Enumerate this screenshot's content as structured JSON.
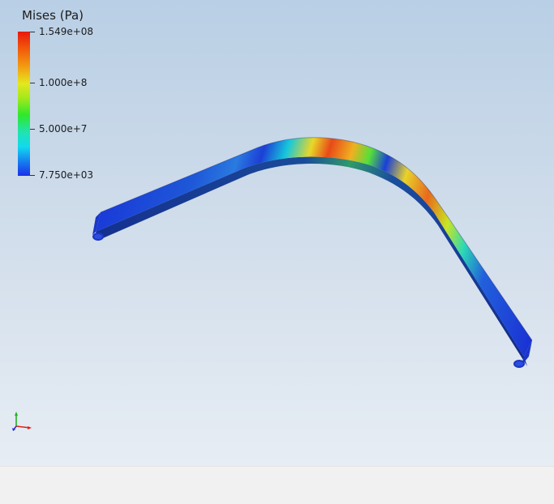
{
  "legend": {
    "title": "Mises (Pa)",
    "max_label": "1.549e+08",
    "mid_high_label": "1.000e+8",
    "mid_low_label": "5.000e+7",
    "min_label": "7.750e+03",
    "colors": [
      "#e8180c",
      "#f3a012",
      "#e4e81e",
      "#2ee82c",
      "#12d9ef",
      "#1a2fe8"
    ]
  },
  "viewport": {
    "background_top": "#b9cfe5",
    "background_bottom": "#e7edf4"
  },
  "axes_triad": {
    "x_color": "#e0201a",
    "y_color": "#22b020",
    "z_color": "#2030d0"
  }
}
